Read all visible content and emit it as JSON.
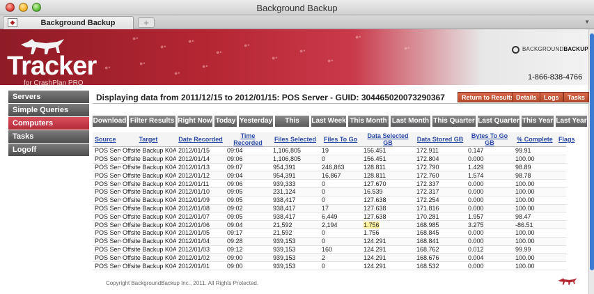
{
  "window": {
    "title": "Background Backup"
  },
  "tab": {
    "label": "Background Backup"
  },
  "banner": {
    "logo_word": "Tracker",
    "logo_sub": "for CrashPlan PRO",
    "brand_left": "BACKGROUND",
    "brand_right": "BACKUP",
    "phone": "1-866-838-4766",
    "colors": {
      "brand_red": "#b52633",
      "button_orange": "#c2543a",
      "nav_active": "#c13a46"
    }
  },
  "sidebar": {
    "items": [
      {
        "label": "Servers",
        "active": false
      },
      {
        "label": "Simple Queries",
        "active": false
      },
      {
        "label": "Computers",
        "active": true
      },
      {
        "label": "Tasks",
        "active": false
      },
      {
        "label": "Logoff",
        "active": false
      }
    ]
  },
  "header": {
    "title": "Displaying data from 2011/12/15 to 2012/01/15: POS Server - GUID: 304465020073290367",
    "buttons": [
      "Return to Results",
      "Details",
      "Logs",
      "Tasks"
    ]
  },
  "filters": [
    "Download",
    "Filter Results",
    "Right Now",
    "Today",
    "Yesterday",
    "This Week",
    "Last Week",
    "This Month",
    "Last Month",
    "This Quarter",
    "Last Quarter",
    "This Year",
    "Last Year"
  ],
  "table": {
    "columns": [
      "Source",
      "Target",
      "Date Recorded",
      "Time Recorded",
      "Files Selected",
      "Files To Go",
      "Data Selected GB",
      "Data Stored GB",
      "Bytes To Go GB",
      "% Complete",
      "Flags"
    ],
    "rows": [
      [
        "POS Server",
        "Offsite Backup K0A",
        "2012/01/15",
        "09:04",
        "1,106,805",
        "19",
        "156.451",
        "172.911",
        "0.147",
        "99.91",
        ""
      ],
      [
        "POS Server",
        "Offsite Backup K0A",
        "2012/01/14",
        "09:06",
        "1,106,805",
        "0",
        "156.451",
        "172.804",
        "0.000",
        "100.00",
        ""
      ],
      [
        "POS Server",
        "Offsite Backup K0A",
        "2012/01/13",
        "09:07",
        "954,391",
        "246,863",
        "128.811",
        "172.790",
        "1.429",
        "98.89",
        ""
      ],
      [
        "POS Server",
        "Offsite Backup K0A",
        "2012/01/12",
        "09:04",
        "954,391",
        "16,867",
        "128.811",
        "172.760",
        "1.574",
        "98.78",
        ""
      ],
      [
        "POS Server",
        "Offsite Backup K0A",
        "2012/01/11",
        "09:06",
        "939,333",
        "0",
        "127.670",
        "172.337",
        "0.000",
        "100.00",
        ""
      ],
      [
        "POS Server",
        "Offsite Backup K0A",
        "2012/01/10",
        "09:05",
        "231,124",
        "0",
        "16.539",
        "172.317",
        "0.000",
        "100.00",
        ""
      ],
      [
        "POS Server",
        "Offsite Backup K0A",
        "2012/01/09",
        "09:05",
        "938,417",
        "0",
        "127.638",
        "172.254",
        "0.000",
        "100.00",
        ""
      ],
      [
        "POS Server",
        "Offsite Backup K0A",
        "2012/01/08",
        "09:02",
        "938,417",
        "17",
        "127.638",
        "171.816",
        "0.000",
        "100.00",
        ""
      ],
      [
        "POS Server",
        "Offsite Backup K0A",
        "2012/01/07",
        "09:05",
        "938,417",
        "6,449",
        "127.638",
        "170.281",
        "1.957",
        "98.47",
        ""
      ],
      [
        "POS Server",
        "Offsite Backup K0A",
        "2012/01/06",
        "09:04",
        "21,592",
        "2,194",
        "1.756",
        "168.985",
        "3.275",
        "-86.51",
        ""
      ],
      [
        "POS Server",
        "Offsite Backup K0A",
        "2012/01/05",
        "09:17",
        "21,592",
        "0",
        "1.756",
        "168.845",
        "0.000",
        "100.00",
        ""
      ],
      [
        "POS Server",
        "Offsite Backup K0A",
        "2012/01/04",
        "09:28",
        "939,153",
        "0",
        "124.291",
        "168.841",
        "0.000",
        "100.00",
        ""
      ],
      [
        "POS Server",
        "Offsite Backup K0A",
        "2012/01/03",
        "09:12",
        "939,153",
        "160",
        "124.291",
        "168.762",
        "0.012",
        "99.99",
        ""
      ],
      [
        "POS Server",
        "Offsite Backup K0A",
        "2012/01/02",
        "09:00",
        "939,153",
        "2",
        "124.291",
        "168.676",
        "0.004",
        "100.00",
        ""
      ],
      [
        "POS Server",
        "Offsite Backup K0A",
        "2012/01/01",
        "09:00",
        "939,153",
        "0",
        "124.291",
        "168.532",
        "0.000",
        "100.00",
        ""
      ]
    ],
    "highlight": {
      "row": 9,
      "col": 6
    }
  },
  "footer": {
    "copyright": "Copyright BackgroundBackup Inc., 2011. All Rights Protected."
  }
}
